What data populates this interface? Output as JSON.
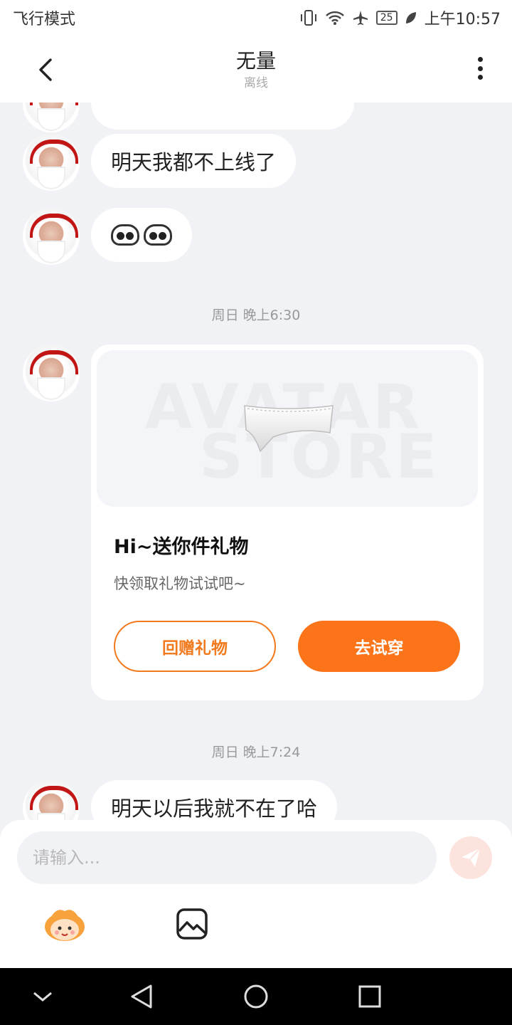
{
  "status_bar": {
    "left_text": "飞行模式",
    "battery_level": "25",
    "time": "上午10:57",
    "icons": [
      "vibrate-icon",
      "wifi-icon",
      "airplane-icon",
      "battery-icon",
      "leaf-icon"
    ]
  },
  "header": {
    "title": "无量",
    "subtitle": "离线",
    "back_icon": "chevron-left-icon",
    "more_icon": "more-vertical-icon"
  },
  "messages": [
    {
      "type": "text",
      "text": "明天我都不上线了"
    },
    {
      "type": "emoji",
      "emoji": [
        "panda-emoji",
        "panda-emoji"
      ]
    },
    {
      "type": "timestamp",
      "text": "周日 晚上6:30"
    },
    {
      "type": "gift_card",
      "image_watermark": [
        "AVATAR",
        "STORE"
      ],
      "title": "Hi~送你件礼物",
      "description": "快领取礼物试试吧~",
      "secondary_button": "回赠礼物",
      "primary_button": "去试穿"
    },
    {
      "type": "timestamp",
      "text": "周日 晚上7:24"
    },
    {
      "type": "text",
      "text": "明天以后我就不在了哈"
    }
  ],
  "composer": {
    "placeholder": "请输入...",
    "send_icon": "send-icon",
    "tools": [
      "mascot-emoji-icon",
      "image-icon"
    ]
  },
  "nav_bar": [
    "collapse-icon",
    "back-icon",
    "home-icon",
    "recents-icon"
  ],
  "colors": {
    "accent": "#fb7419",
    "background": "#f0f2f6",
    "send_disabled": "#fde3dd"
  }
}
